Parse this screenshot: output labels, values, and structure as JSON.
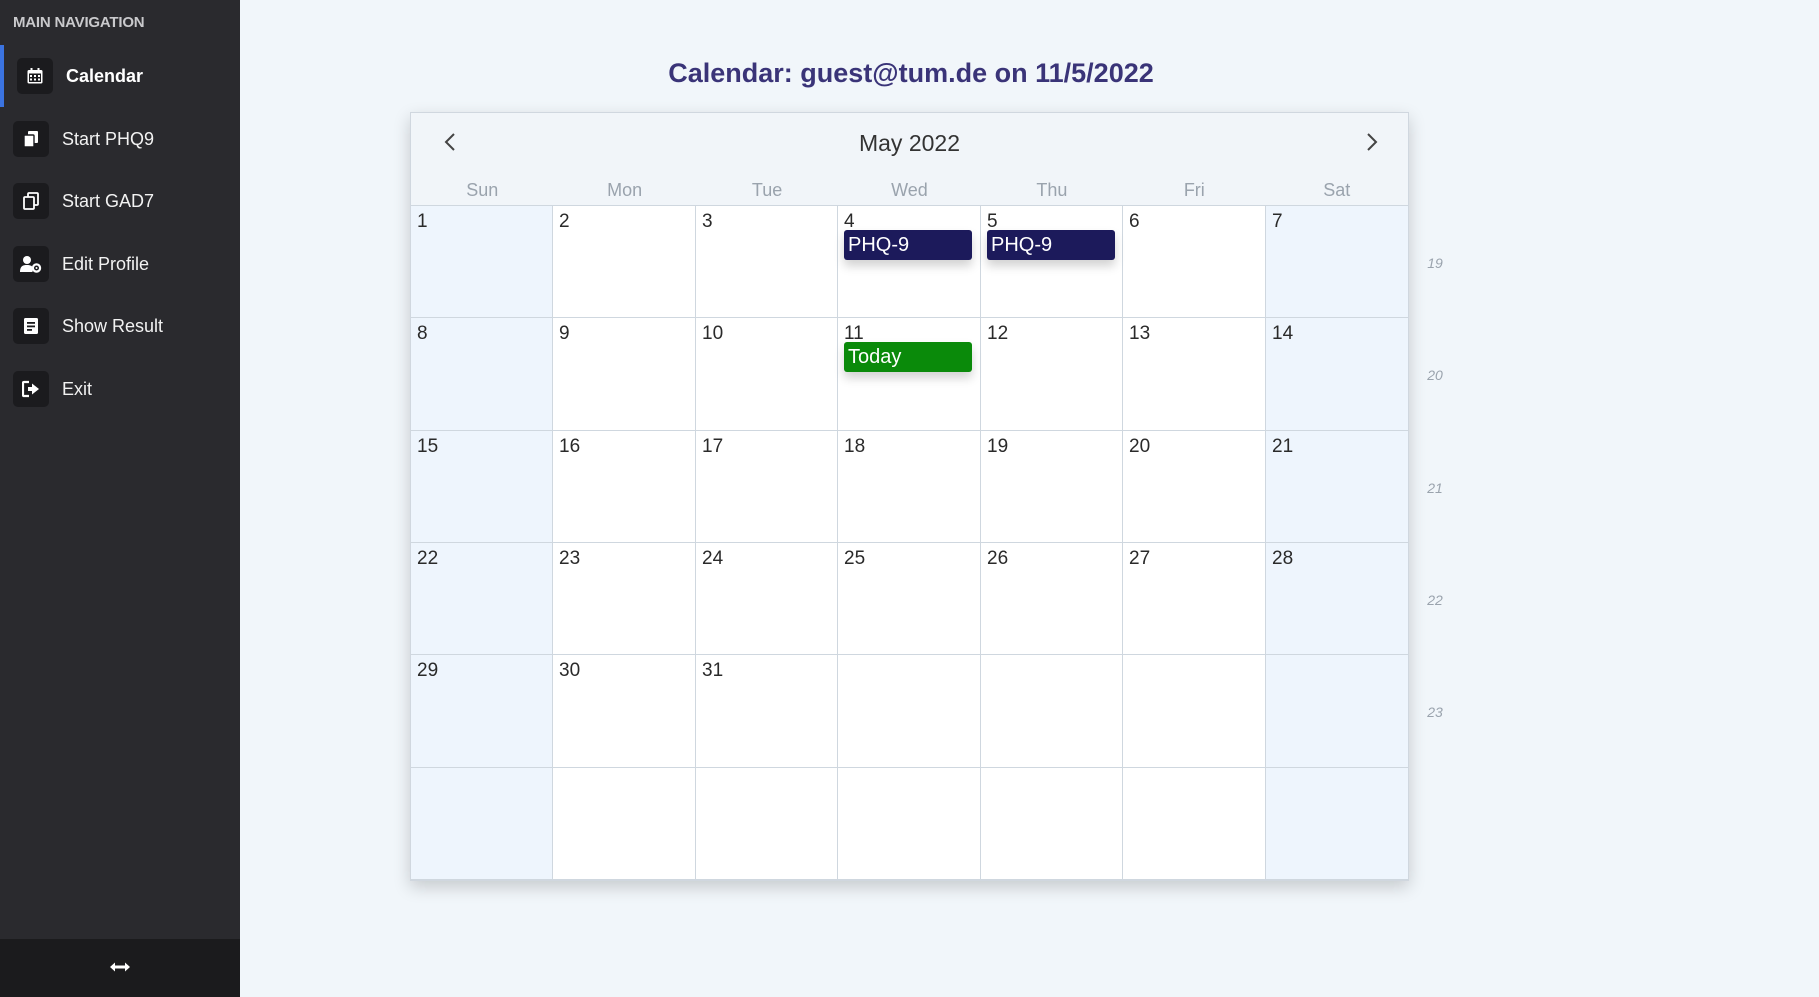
{
  "sidebar": {
    "heading": "MAIN NAVIGATION",
    "items": [
      {
        "label": "Calendar",
        "icon": "calendar-icon",
        "active": true
      },
      {
        "label": "Start PHQ9",
        "icon": "copy-icon",
        "active": false
      },
      {
        "label": "Start GAD7",
        "icon": "clone-icon",
        "active": false
      },
      {
        "label": "Edit Profile",
        "icon": "user-cog-icon",
        "active": false
      },
      {
        "label": "Show Result",
        "icon": "document-icon",
        "active": false
      },
      {
        "label": "Exit",
        "icon": "sign-out-icon",
        "active": false
      }
    ],
    "footer_icon": "resize-horizontal-icon",
    "accent": "#3b73e0"
  },
  "page": {
    "title": "Calendar: guest@tum.de on 11/5/2022"
  },
  "calendar": {
    "month_title": "May 2022",
    "weekdays": [
      "Sun",
      "Mon",
      "Tue",
      "Wed",
      "Thu",
      "Fri",
      "Sat"
    ],
    "weeks": [
      [
        "1",
        "2",
        "3",
        "4",
        "5",
        "6",
        "7"
      ],
      [
        "8",
        "9",
        "10",
        "11",
        "12",
        "13",
        "14"
      ],
      [
        "15",
        "16",
        "17",
        "18",
        "19",
        "20",
        "21"
      ],
      [
        "22",
        "23",
        "24",
        "25",
        "26",
        "27",
        "28"
      ],
      [
        "29",
        "30",
        "31",
        "",
        "",
        "",
        ""
      ],
      [
        "",
        "",
        "",
        "",
        "",
        "",
        ""
      ]
    ],
    "week_numbers": [
      "19",
      "20",
      "21",
      "22",
      "23"
    ],
    "events": [
      {
        "day": "4",
        "label": "PHQ-9",
        "color": "#1c1a5b"
      },
      {
        "day": "5",
        "label": "PHQ-9",
        "color": "#1c1a5b"
      },
      {
        "day": "11",
        "label": "Today",
        "color": "#0a8a0a"
      }
    ]
  }
}
